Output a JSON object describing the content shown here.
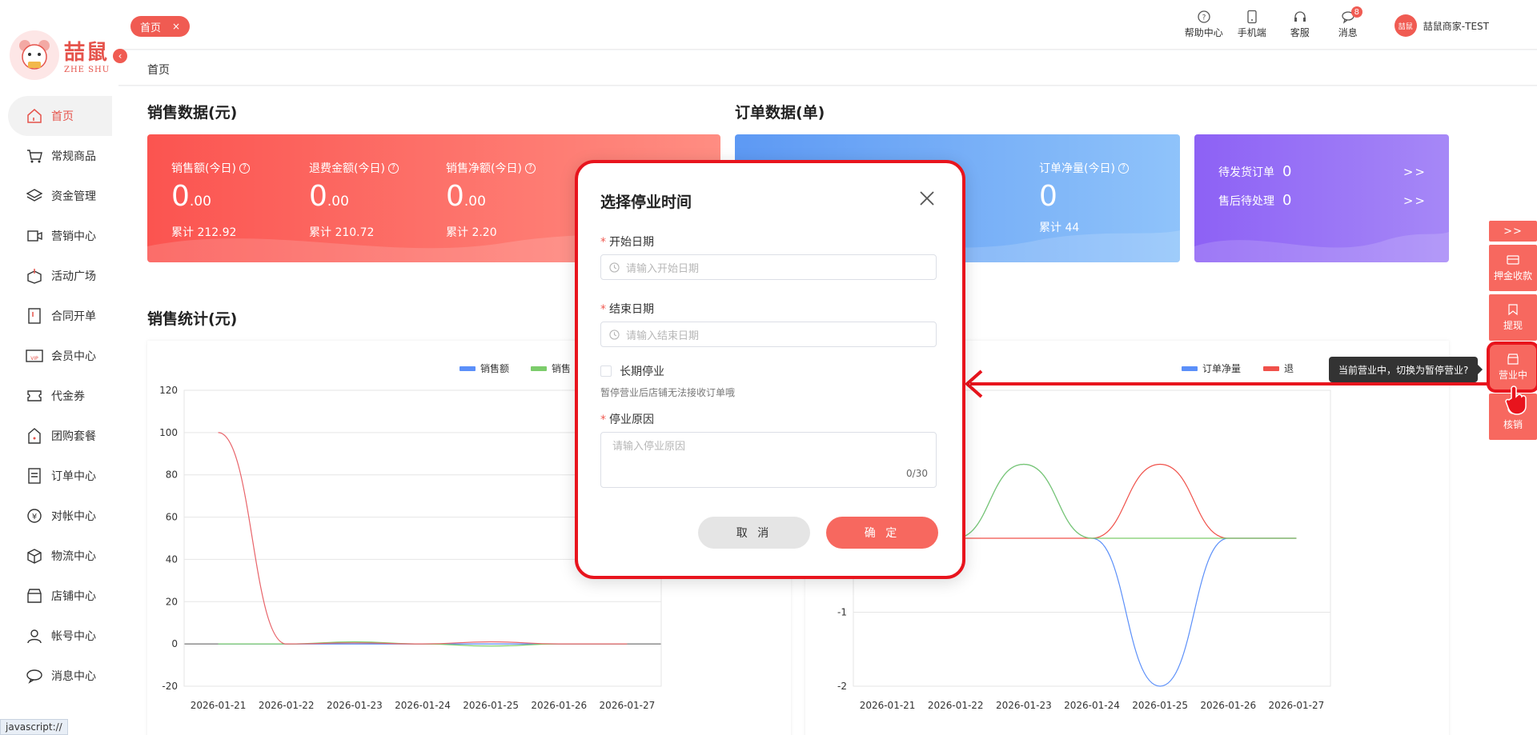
{
  "sidebar": {
    "logo": {
      "cn": "喆鼠",
      "en": "ZHE SHU"
    },
    "collapse_icon": "chevron-left-icon",
    "items": [
      {
        "label": "首页",
        "icon": "home-icon",
        "active": true
      },
      {
        "label": "常规商品",
        "icon": "cart-icon"
      },
      {
        "label": "资金管理",
        "icon": "layers-icon"
      },
      {
        "label": "营销中心",
        "icon": "marketing-icon"
      },
      {
        "label": "活动广场",
        "icon": "box-icon"
      },
      {
        "label": "合同开单",
        "icon": "contract-icon"
      },
      {
        "label": "会员中心",
        "icon": "vip-icon"
      },
      {
        "label": "代金券",
        "icon": "coupon-icon"
      },
      {
        "label": "团购套餐",
        "icon": "group-buy-icon"
      },
      {
        "label": "订单中心",
        "icon": "order-icon"
      },
      {
        "label": "对帐中心",
        "icon": "yen-icon"
      },
      {
        "label": "物流中心",
        "icon": "logistics-icon"
      },
      {
        "label": "店铺中心",
        "icon": "store-icon"
      },
      {
        "label": "帐号中心",
        "icon": "user-icon"
      },
      {
        "label": "消息中心",
        "icon": "message-icon"
      }
    ]
  },
  "topbar": {
    "tab": {
      "label": "首页",
      "close": "×"
    },
    "tools": [
      {
        "label": "帮助中心",
        "icon": "help-icon"
      },
      {
        "label": "手机端",
        "icon": "mobile-icon"
      },
      {
        "label": "客服",
        "icon": "headset-icon"
      },
      {
        "label": "消息",
        "icon": "message-icon",
        "badge": "8"
      }
    ],
    "user": {
      "avatar_text": "喆鼠",
      "name": "喆鼠商家-TEST"
    }
  },
  "breadcrumb": "首页",
  "sales_section": {
    "title": "销售数据(元)",
    "metrics": [
      {
        "label": "销售额(今日)",
        "int": "0",
        "dec": ".00",
        "acc": "累计 212.92"
      },
      {
        "label": "退费金额(今日)",
        "int": "0",
        "dec": ".00",
        "acc": "累计 210.72"
      },
      {
        "label": "销售净额(今日)",
        "int": "0",
        "dec": ".00",
        "acc": "累计 2.20"
      }
    ]
  },
  "order_section": {
    "title": "订单数据(单)",
    "metrics": [
      {
        "label": "订单净量(今日)",
        "value": "0",
        "acc": "累计 44"
      }
    ]
  },
  "pending": {
    "rows": [
      {
        "label": "待发货订单",
        "count": "0",
        "arrow": ">>"
      },
      {
        "label": "售后待处理",
        "count": "0",
        "arrow": ">>"
      }
    ]
  },
  "stats_title": "销售统计(元)",
  "float_panel": {
    "top": ">>",
    "buttons": [
      {
        "label": "押金收款",
        "icon": "card-icon"
      },
      {
        "label": "提现",
        "icon": "bookmark-icon"
      },
      {
        "label": "营业中",
        "icon": "shop-icon"
      },
      {
        "label": "核销",
        "icon": "verify-icon"
      }
    ],
    "tooltip": "当前营业中，切换为暂停营业?"
  },
  "modal": {
    "title": "选择停业时间",
    "start_label": "开始日期",
    "start_placeholder": "请输入开始日期",
    "end_label": "结束日期",
    "end_placeholder": "请输入结束日期",
    "long_term_label": "长期停业",
    "hint": "暂停营业后店铺无法接收订单哦",
    "reason_label": "停业原因",
    "reason_placeholder": "请输入停业原因",
    "reason_count": "0/30",
    "cancel": "取 消",
    "ok": "确 定"
  },
  "status_bar": "javascript://",
  "colors": {
    "accent": "#f05b52",
    "highlight": "#e8141d",
    "blue": "#5d99f4",
    "green": "#7ccc6b",
    "purple": "#8d61f5"
  },
  "chart_data": [
    {
      "type": "line",
      "categories": [
        "2026-01-21",
        "2026-01-22",
        "2026-01-23",
        "2026-01-24",
        "2026-01-25",
        "2026-01-26",
        "2026-01-27"
      ],
      "ylim": [
        -20,
        120
      ],
      "yticks": [
        120,
        100,
        80,
        60,
        40,
        20,
        0,
        -20
      ],
      "series": [
        {
          "name": "销售额",
          "color": "#5b8ff9",
          "values": [
            0,
            0,
            0,
            0,
            0,
            0,
            0
          ]
        },
        {
          "name": "销售",
          "color": "#7ccc6b",
          "values": [
            0,
            0,
            1,
            0,
            -1,
            0,
            0
          ]
        },
        {
          "color": "#e8646a",
          "values": [
            100,
            0,
            0.5,
            0,
            1,
            0,
            0
          ]
        }
      ]
    },
    {
      "type": "line",
      "categories": [
        "2026-01-21",
        "2026-01-22",
        "2026-01-23",
        "2026-01-24",
        "2026-01-25",
        "2026-01-26",
        "2026-01-27"
      ],
      "ylim": [
        -2,
        2
      ],
      "yticks": [
        -1,
        -2
      ],
      "series": [
        {
          "name": "订单净量",
          "color": "#5b8ff9",
          "values": [
            0,
            0,
            1,
            0,
            -2,
            0,
            0
          ]
        },
        {
          "name": "退",
          "color": "#f0514a",
          "values": [
            0,
            0,
            0,
            0,
            1,
            0,
            0
          ]
        },
        {
          "color": "#7ccc6b",
          "values": [
            0,
            0,
            1,
            0,
            0,
            0,
            0
          ]
        }
      ]
    }
  ]
}
